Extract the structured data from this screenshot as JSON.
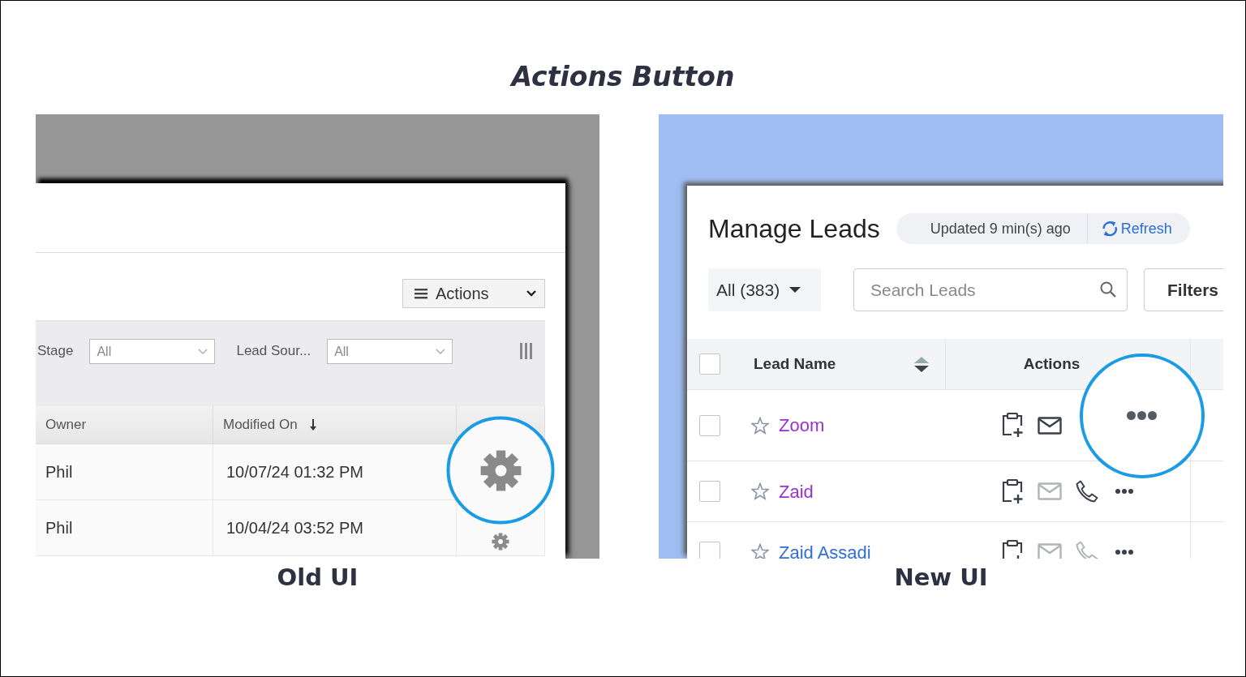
{
  "title": "Actions Button",
  "panels": [
    {
      "kind": "old",
      "caption": "Old UI",
      "actions_button": {
        "label": "Actions"
      },
      "filters": [
        {
          "label": "Stage",
          "value": "All"
        },
        {
          "label": "Lead Sour...",
          "value": "All"
        }
      ],
      "columns": [
        {
          "label": "Owner",
          "sorted": false
        },
        {
          "label": "Modified On",
          "sorted": true
        }
      ],
      "rows": [
        {
          "owner": "Phil",
          "modified_on": "10/07/24 01:32 PM",
          "highlighted": true
        },
        {
          "owner": "Phil",
          "modified_on": "10/04/24 03:52 PM",
          "highlighted": false
        }
      ]
    },
    {
      "kind": "new",
      "caption": "New UI",
      "heading": "Manage Leads",
      "updated": "Updated 9 min(s) ago",
      "refresh": "Refresh",
      "view": "All (383)",
      "search": {
        "placeholder": "Search Leads"
      },
      "filters_button": "Filters",
      "all_checked": false,
      "columns": [
        {
          "label": "Lead Name",
          "sortable": true
        },
        {
          "label": "Actions",
          "sortable": false
        }
      ],
      "rows": [
        {
          "name": "Zoom",
          "visited": true,
          "checked": false,
          "starred": false,
          "highlighted": true,
          "actions": [
            {
              "kind": "note",
              "enabled": true
            },
            {
              "kind": "email",
              "enabled": true
            },
            {
              "kind": "more",
              "enabled": true
            }
          ]
        },
        {
          "name": "Zaid",
          "visited": true,
          "checked": false,
          "starred": false,
          "highlighted": false,
          "actions": [
            {
              "kind": "note",
              "enabled": true
            },
            {
              "kind": "email",
              "enabled": false
            },
            {
              "kind": "phone",
              "enabled": true
            },
            {
              "kind": "more",
              "enabled": true
            }
          ]
        },
        {
          "name": "Zaid Assadi",
          "visited": false,
          "checked": false,
          "starred": false,
          "highlighted": false,
          "actions": [
            {
              "kind": "note",
              "enabled": true
            },
            {
              "kind": "email",
              "enabled": false
            },
            {
              "kind": "phone",
              "enabled": false
            },
            {
              "kind": "more",
              "enabled": true
            }
          ]
        }
      ]
    }
  ]
}
